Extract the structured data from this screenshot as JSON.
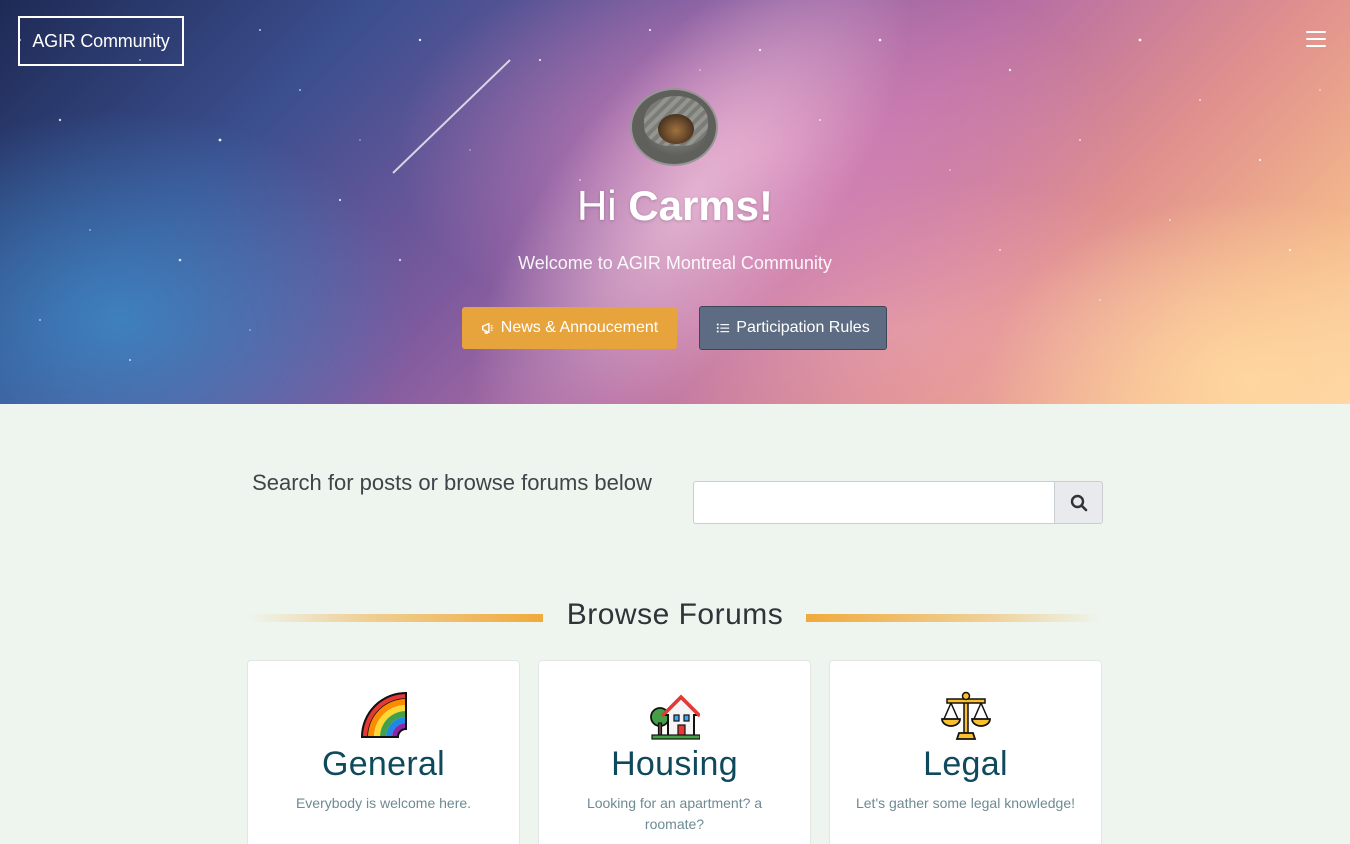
{
  "brand": {
    "label": "AGIR Community"
  },
  "header": {
    "menu_icon": "hamburger-menu-icon"
  },
  "hero": {
    "greeting_prefix": "Hi ",
    "user_name": "Carms!",
    "welcome": "Welcome to AGIR Montreal Community",
    "buttons": {
      "news": {
        "label": "News & Annoucement",
        "icon": "megaphone-icon",
        "color": "#e7a43c"
      },
      "rules": {
        "label": "Participation Rules",
        "icon": "list-icon",
        "color": "#5e6c83"
      }
    }
  },
  "search": {
    "prompt": "Search for posts or browse forums below",
    "placeholder": "",
    "button_icon": "search-icon"
  },
  "browse": {
    "title": "Browse Forums",
    "accent_color": "#f0aa3c",
    "forums": [
      {
        "title": "General",
        "description": "Everybody is welcome here.",
        "icon": "rainbow-icon"
      },
      {
        "title": "Housing",
        "description": "Looking for an apartment? a roomate?",
        "icon": "house-icon"
      },
      {
        "title": "Legal",
        "description": "Let's gather some legal knowledge!",
        "icon": "scales-icon"
      }
    ]
  }
}
